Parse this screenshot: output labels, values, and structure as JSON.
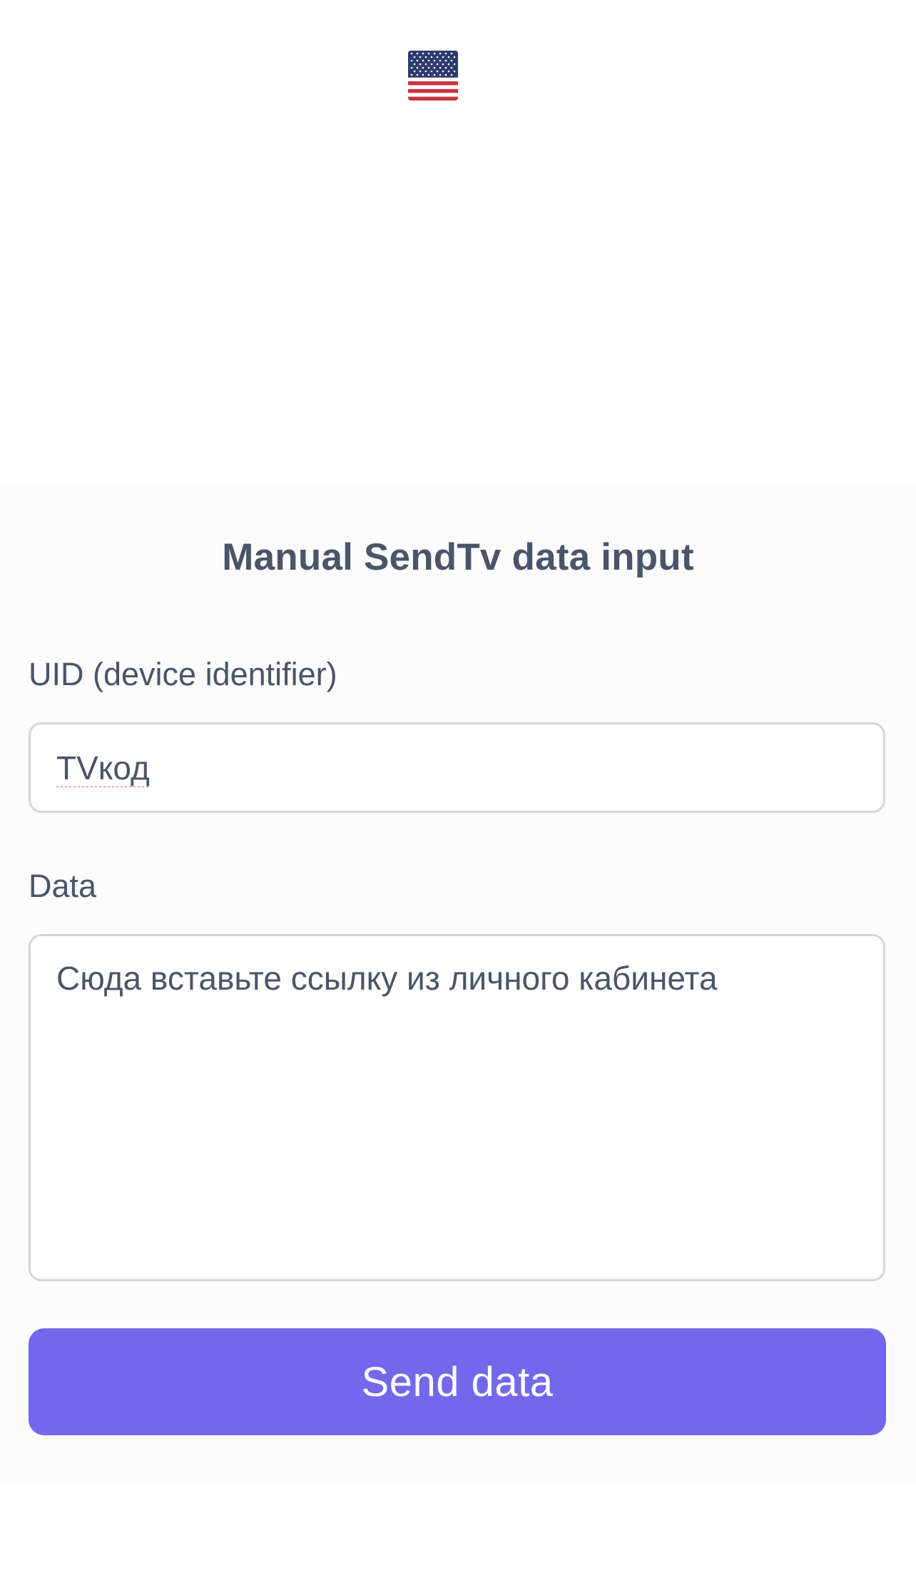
{
  "language": {
    "current_icon": "us-flag-icon"
  },
  "form": {
    "title": "Manual SendTv data input",
    "uid": {
      "label": "UID (device identifier)",
      "value": "TVкод"
    },
    "data": {
      "label": "Data",
      "placeholder": "Сюда вставьте ссылку из личного кабинета",
      "value": ""
    },
    "submit_label": "Send data"
  },
  "colors": {
    "accent": "#7268ec",
    "text": "#4a5568",
    "border": "#d5d6db"
  }
}
